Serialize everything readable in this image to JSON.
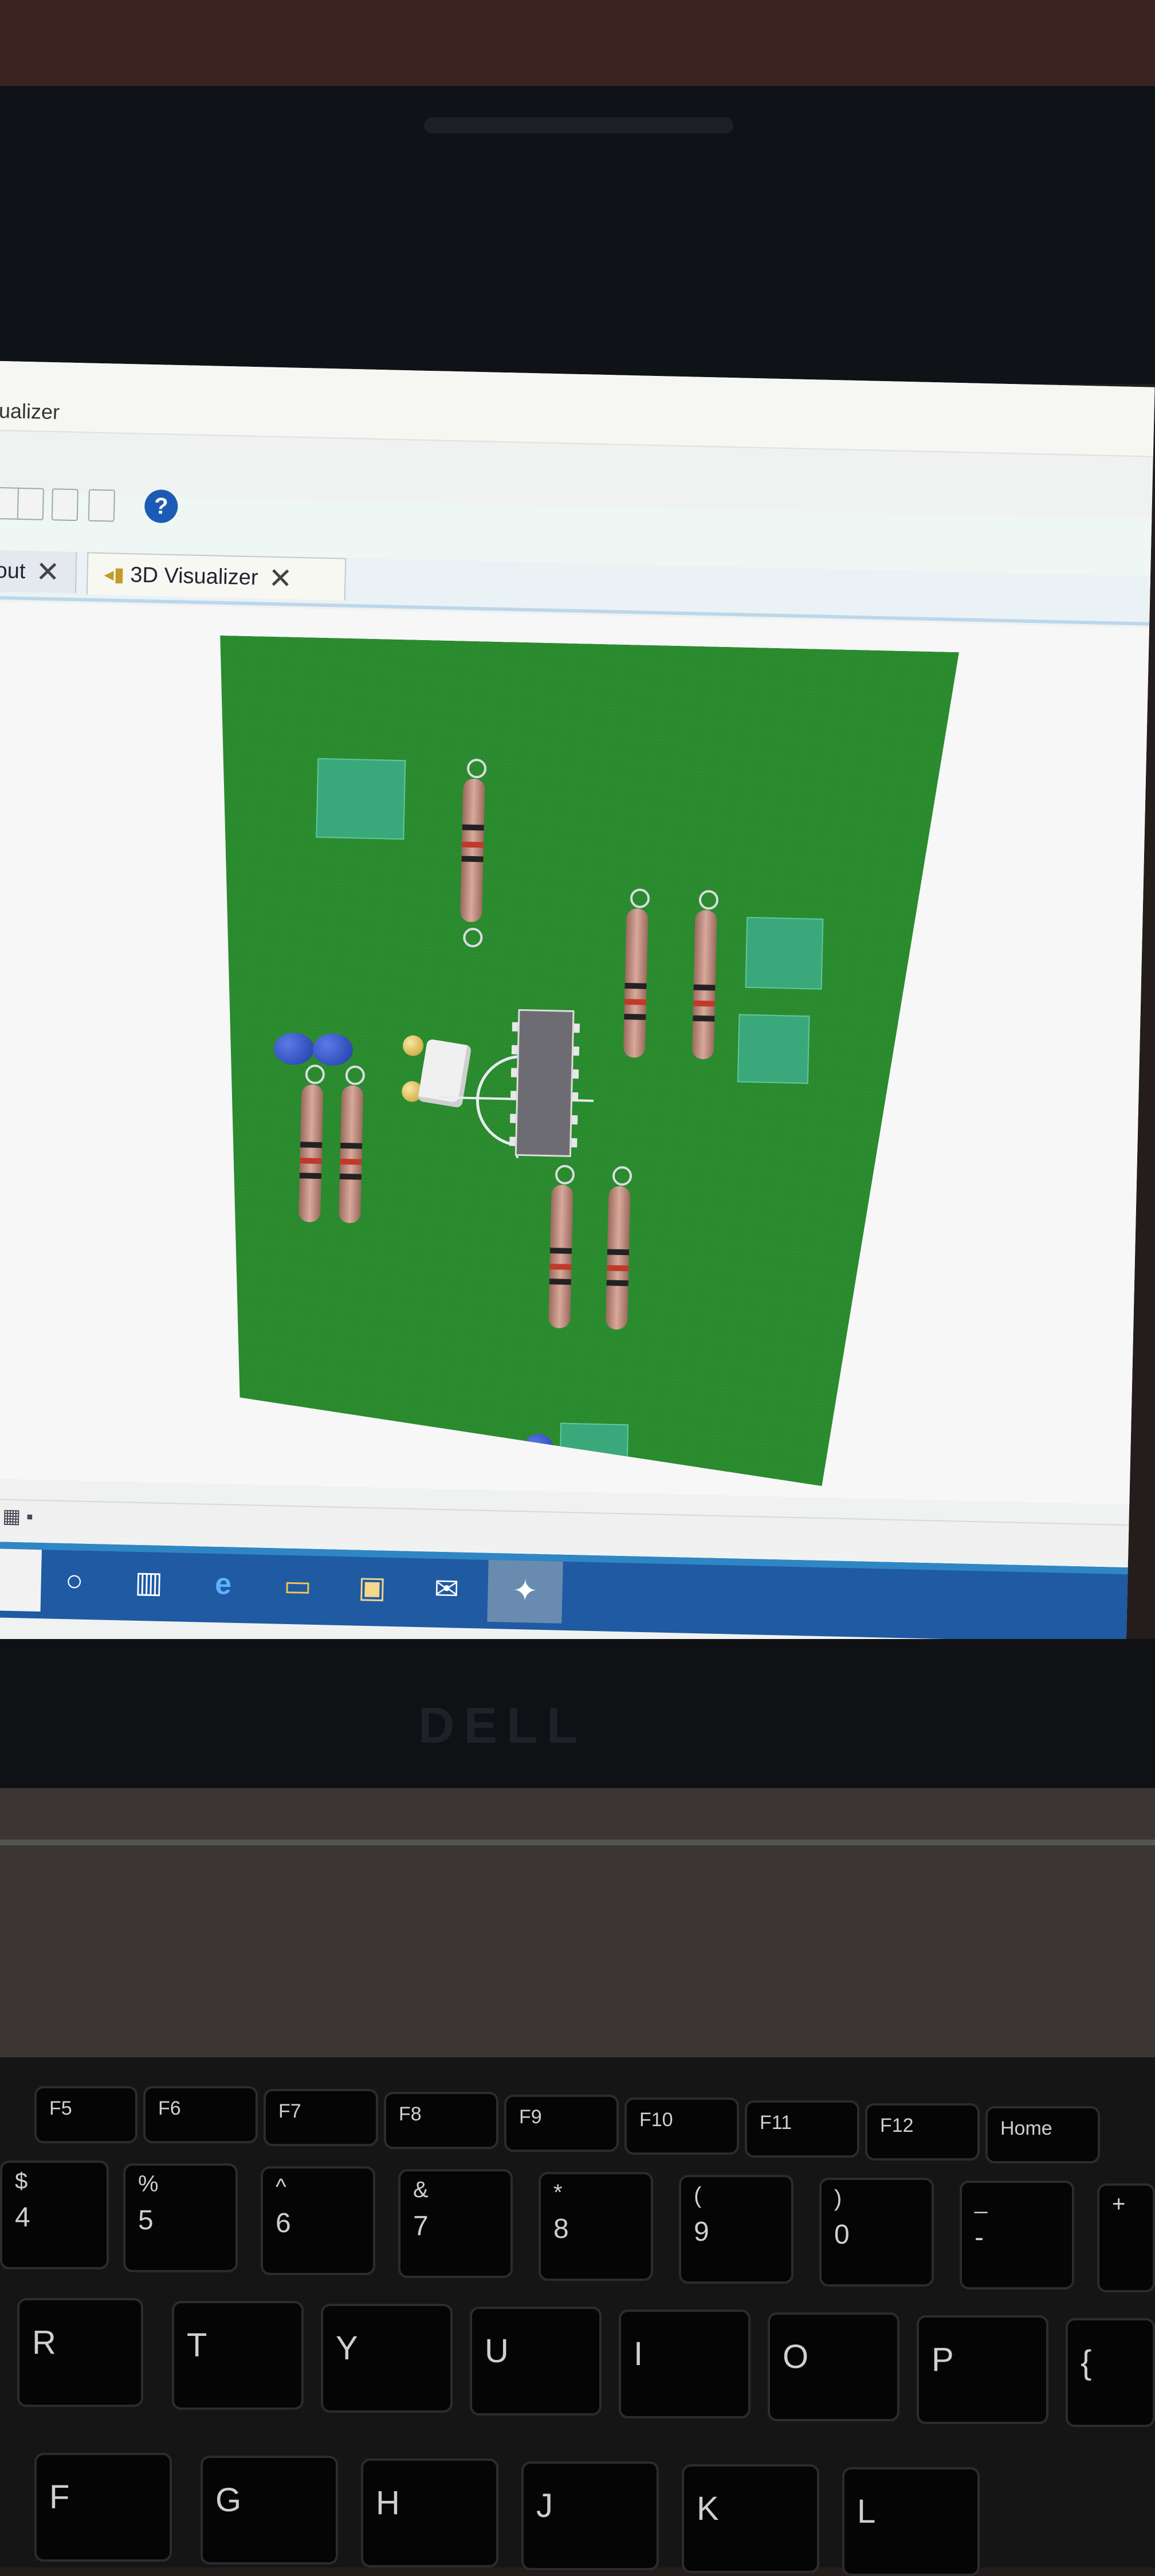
{
  "window": {
    "title": "ualizer"
  },
  "tabs": [
    {
      "label": "out",
      "close": "✕"
    },
    {
      "label": "3D Visualizer",
      "close": "✕"
    }
  ],
  "toolbar": {
    "help_icon": "?"
  },
  "taskbar": {
    "icons": [
      "cortana-icon",
      "task-view-icon",
      "edge-icon",
      "file-explorer-icon",
      "store-icon",
      "mail-icon",
      "proteus-icon"
    ]
  },
  "laptop": {
    "brand": "DELL"
  },
  "keyboard": {
    "fn_row": [
      "F5",
      "F6",
      "F7",
      "F8",
      "F9",
      "F10",
      "F11",
      "F12",
      "Home"
    ],
    "num_row": [
      {
        "top": "$",
        "bottom": "4"
      },
      {
        "top": "%",
        "bottom": "5"
      },
      {
        "top": "^",
        "bottom": "6"
      },
      {
        "top": "&",
        "bottom": "7"
      },
      {
        "top": "*",
        "bottom": "8"
      },
      {
        "top": "(",
        "bottom": "9"
      },
      {
        "top": ")",
        "bottom": "0"
      },
      {
        "top": "_",
        "bottom": "-"
      },
      {
        "top": "+",
        "bottom": ""
      }
    ],
    "top_row": [
      "R",
      "T",
      "Y",
      "U",
      "I",
      "O",
      "P",
      "{"
    ],
    "home_row": [
      "F",
      "G",
      "H",
      "J",
      "K",
      "L"
    ]
  },
  "colors": {
    "pcb": "#2a8a2e",
    "taskbar": "#1f5aa3",
    "tab_accent": "#bcd7ea",
    "help": "#1b5bb5"
  }
}
